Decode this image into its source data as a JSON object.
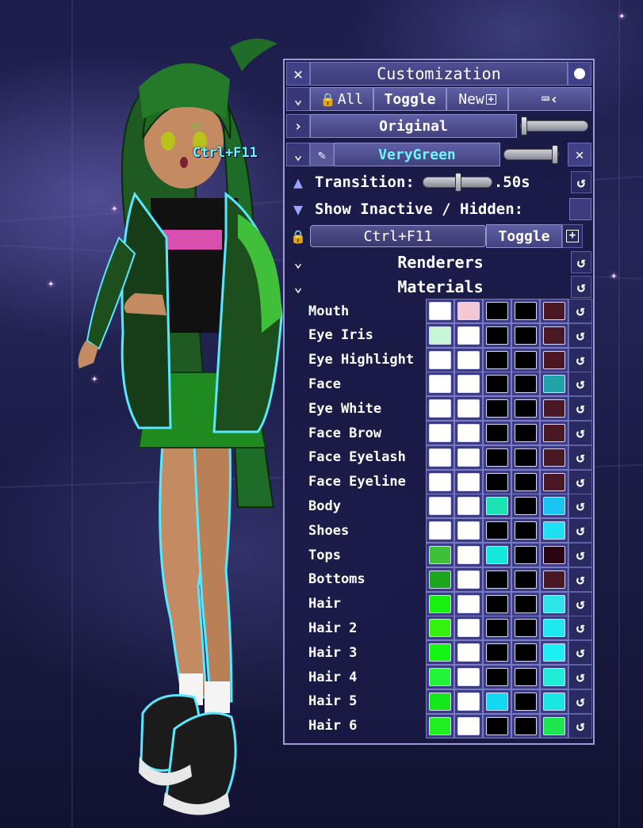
{
  "hotkey_overlay": "Ctrl+F11",
  "panel": {
    "title": "Customization",
    "toolbar": {
      "all_label": "All",
      "toggle_label": "Toggle",
      "new_label": "New"
    },
    "preset_original": {
      "name": "Original",
      "slider_value": 0.05
    },
    "preset_active": {
      "name": "VeryGreen",
      "slider_value": 1.0
    },
    "transition": {
      "label": "Transition:",
      "value": ".50s",
      "slider_value": 0.5
    },
    "show_inactive": {
      "label": "Show Inactive / Hidden:"
    },
    "hotkey": {
      "value": "Ctrl+F11",
      "toggle_label": "Toggle"
    },
    "sections": {
      "renderers": "Renderers",
      "materials": "Materials"
    },
    "materials": [
      {
        "name": "Mouth",
        "colors": [
          "#ffffff",
          "#f3c8d4",
          "#000000",
          "#000000",
          "#4a1822"
        ]
      },
      {
        "name": "Eye Iris",
        "colors": [
          "#c5f7d6",
          "#ffffff",
          "#000000",
          "#000000",
          "#4a1822"
        ]
      },
      {
        "name": "Eye Highlight",
        "colors": [
          "#ffffff",
          "#ffffff",
          "#000000",
          "#000000",
          "#4a1822"
        ]
      },
      {
        "name": "Face",
        "colors": [
          "#ffffff",
          "#ffffff",
          "#000000",
          "#000000",
          "#1fa3a8"
        ]
      },
      {
        "name": "Eye White",
        "colors": [
          "#ffffff",
          "#ffffff",
          "#000000",
          "#000000",
          "#4a1822"
        ]
      },
      {
        "name": "Face Brow",
        "colors": [
          "#ffffff",
          "#ffffff",
          "#000000",
          "#000000",
          "#4a1822"
        ]
      },
      {
        "name": "Face Eyelash",
        "colors": [
          "#ffffff",
          "#ffffff",
          "#000000",
          "#000000",
          "#4a1822"
        ]
      },
      {
        "name": "Face Eyeline",
        "colors": [
          "#ffffff",
          "#ffffff",
          "#000000",
          "#000000",
          "#4a1822"
        ]
      },
      {
        "name": "Body",
        "colors": [
          "#ffffff",
          "#ffffff",
          "#1ce3b4",
          "#000000",
          "#19c4f2"
        ]
      },
      {
        "name": "Shoes",
        "colors": [
          "#ffffff",
          "#ffffff",
          "#000000",
          "#000000",
          "#1fe0f2"
        ]
      },
      {
        "name": "Tops",
        "colors": [
          "#3fbf3a",
          "#ffffff",
          "#14e8dc",
          "#000000",
          "#2b0612"
        ]
      },
      {
        "name": "Bottoms",
        "colors": [
          "#1ea61e",
          "#ffffff",
          "#000000",
          "#000000",
          "#4a1822"
        ]
      },
      {
        "name": "Hair",
        "colors": [
          "#18f00e",
          "#ffffff",
          "#000000",
          "#000000",
          "#2ee6ea"
        ]
      },
      {
        "name": "Hair 2",
        "colors": [
          "#36f00e",
          "#ffffff",
          "#000000",
          "#000000",
          "#20e8f0"
        ]
      },
      {
        "name": "Hair 3",
        "colors": [
          "#14f514",
          "#ffffff",
          "#000000",
          "#000000",
          "#1cf0f4"
        ]
      },
      {
        "name": "Hair 4",
        "colors": [
          "#22f238",
          "#ffffff",
          "#000000",
          "#000000",
          "#20ecd8"
        ]
      },
      {
        "name": "Hair 5",
        "colors": [
          "#14e81a",
          "#ffffff",
          "#12d8f4",
          "#000000",
          "#18e8e0"
        ]
      },
      {
        "name": "Hair 6",
        "colors": [
          "#20f020",
          "#ffffff",
          "#000000",
          "#000000",
          "#1ee64e"
        ]
      }
    ]
  }
}
